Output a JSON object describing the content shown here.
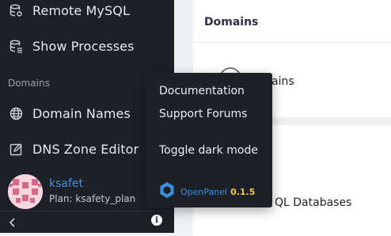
{
  "sidebar": {
    "items_top": [
      {
        "label": "Remote MySQL",
        "icon": "database-gear-icon"
      },
      {
        "label": "Show Processes",
        "icon": "database-list-icon"
      }
    ],
    "section_title": "Domains",
    "items_domains": [
      {
        "label": "Domain Names",
        "icon": "globe-icon"
      },
      {
        "label": "DNS Zone Editor",
        "icon": "edit-icon"
      }
    ],
    "user": {
      "name": "ksafet",
      "plan": "Plan: ksafety_plan"
    }
  },
  "main": {
    "domains_card": {
      "title": "Domains",
      "item_partial": "ains"
    },
    "databases_card": {
      "item_partial": "QL Databases"
    }
  },
  "popup": {
    "links": [
      "Documentation",
      "Support Forums",
      "Toggle dark mode"
    ],
    "brand": {
      "name": "OpenPanel",
      "version": "0.1.5"
    }
  },
  "colors": {
    "sidebar_bg": "#1d2027",
    "accent": "#4a90e2",
    "version": "#f2c94c"
  }
}
